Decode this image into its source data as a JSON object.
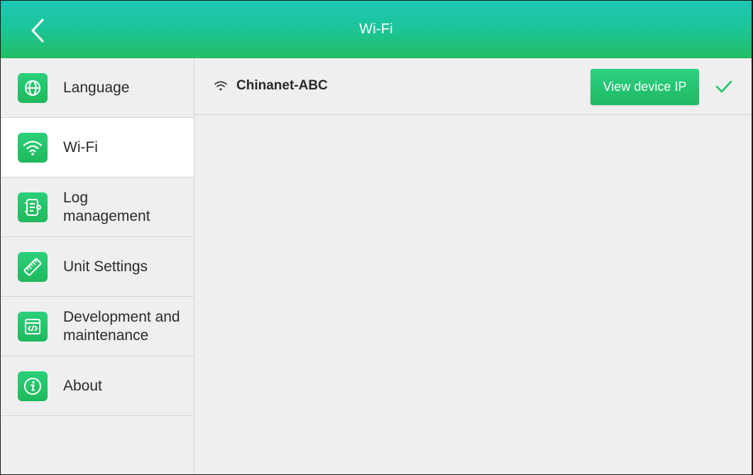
{
  "header": {
    "title": "Wi-Fi",
    "back_icon": "chevron-left-icon"
  },
  "sidebar": {
    "items": [
      {
        "label": "Language",
        "icon": "globe-icon",
        "active": false
      },
      {
        "label": "Wi-Fi",
        "icon": "wifi-icon",
        "active": true
      },
      {
        "label": "Log\nmanagement",
        "icon": "log-icon",
        "active": false
      },
      {
        "label": "Unit Settings",
        "icon": "ruler-icon",
        "active": false
      },
      {
        "label": "Development and\nmaintenance",
        "icon": "code-icon",
        "active": false
      },
      {
        "label": "About",
        "icon": "info-icon",
        "active": false
      }
    ]
  },
  "main": {
    "network": {
      "name": "Chinanet-ABC",
      "connected": true
    },
    "view_ip_label": "View device IP"
  },
  "colors": {
    "accent": "#22c36a",
    "header_top": "#1fc7b6",
    "header_bottom": "#22bd63",
    "background": "#efefef"
  }
}
